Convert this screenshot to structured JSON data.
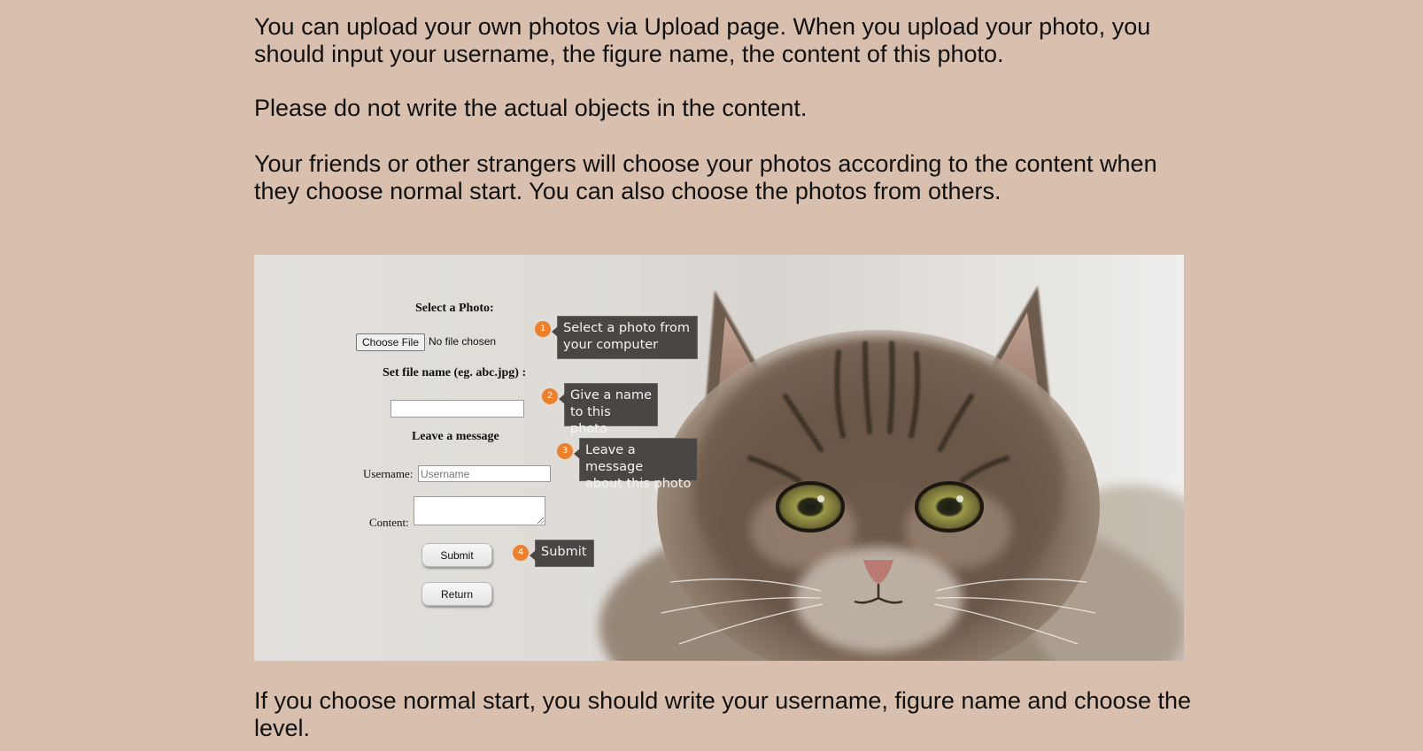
{
  "intro": {
    "paragraph_1": "You can upload your own photos via Upload page. When you upload your photo, you should input your username, the figure name, the content of this photo.",
    "paragraph_2": "Please do not write the actual objects in the content.",
    "paragraph_3": "Your friends or other strangers will choose your photos according to the content when they choose normal start. You can also choose the photos from others."
  },
  "screenshot": {
    "form": {
      "select_photo_heading": "Select a Photo:",
      "choose_file_label": "Choose File",
      "file_status": "No file chosen",
      "file_name_heading": "Set file name (eg. abc.jpg) :",
      "file_name_value": "",
      "message_heading": "Leave a message",
      "username_label": "Username:",
      "username_placeholder": "Username",
      "content_label": "Content:",
      "submit_label": "Submit",
      "return_label": "Return"
    },
    "callouts": [
      {
        "number": "1",
        "text_line1": "Select a photo from",
        "text_line2": "your computer"
      },
      {
        "number": "2",
        "text_line1": "Give a name",
        "text_line2": "to this photo"
      },
      {
        "number": "3",
        "text_line1": "Leave a message",
        "text_line2": "about this photo"
      },
      {
        "number": "4",
        "text_line1": "Submit"
      }
    ],
    "colors": {
      "badge": "#ee7f2d",
      "tooltip": "#4a4644"
    }
  },
  "outro": {
    "paragraph_1": "If you choose normal start, you should write your username, figure name and choose the level."
  },
  "colors": {
    "page_background": "#d9bfae"
  }
}
